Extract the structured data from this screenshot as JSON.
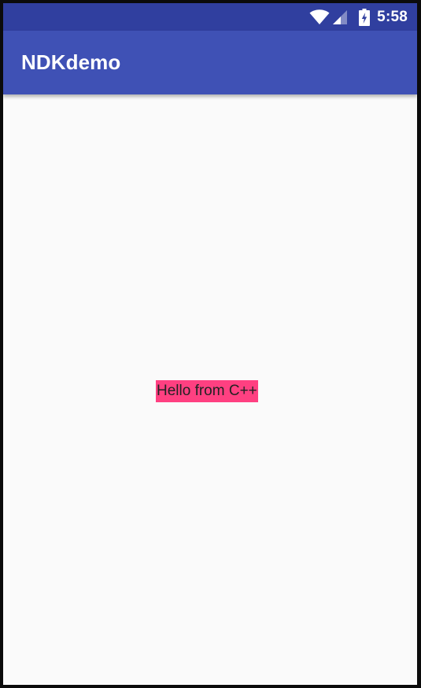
{
  "status_bar": {
    "time": "5:58",
    "icons": [
      "wifi-icon",
      "cell-signal-icon",
      "battery-charging-icon"
    ],
    "background_color": "#303f9f"
  },
  "app_bar": {
    "title": "NDKdemo",
    "background_color": "#3f51b5"
  },
  "main": {
    "message": "Hello from C++",
    "message_background_color": "#ff4081"
  }
}
